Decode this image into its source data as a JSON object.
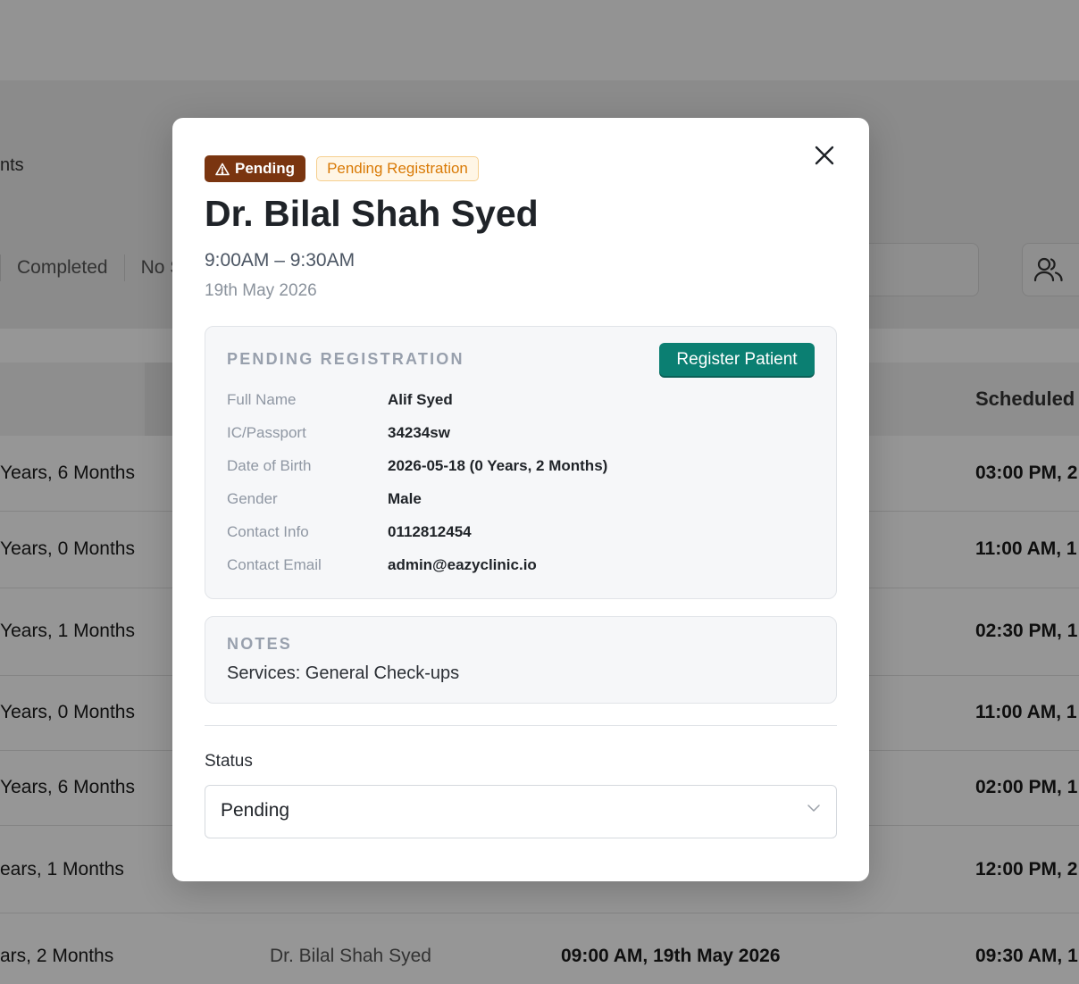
{
  "background": {
    "page_title_fragment": "nts",
    "tabs": [
      "Completed",
      "No S"
    ],
    "table_header_scheduled": "Scheduled E",
    "rows": [
      {
        "age": "Years, 6 Months",
        "time": "03:00 PM, 2"
      },
      {
        "age": "Years, 0 Months",
        "time": "11:00 AM, 1"
      },
      {
        "age": "Years, 1 Months",
        "time": "02:30 PM, 1"
      },
      {
        "age": "Years, 0 Months",
        "time": "11:00 AM, 1"
      },
      {
        "age": "Years, 6 Months",
        "time": "02:00 PM, 1"
      },
      {
        "age": "ears, 1 Months",
        "time": "12:00 PM, 2"
      },
      {
        "age": "ars, 2 Months",
        "doctor": "Dr. Bilal Shah Syed",
        "appointment": "09:00 AM, 19th May 2026",
        "time": "09:30 AM, 1"
      }
    ]
  },
  "modal": {
    "status_badge": "Pending",
    "status_badge_icon": "warning-icon",
    "registration_badge": "Pending Registration",
    "doctor_name": "Dr. Bilal Shah Syed",
    "time_range": "9:00AM – 9:30AM",
    "date": "19th May 2026",
    "pending_registration": {
      "title": "PENDING REGISTRATION",
      "register_button": "Register Patient",
      "fields": [
        {
          "label": "Full Name",
          "value": "Alif Syed"
        },
        {
          "label": "IC/Passport",
          "value": "34234sw"
        },
        {
          "label": "Date of Birth",
          "value": "2026-05-18 (0 Years, 2 Months)"
        },
        {
          "label": "Gender",
          "value": "Male"
        },
        {
          "label": "Contact Info",
          "value": "0112812454"
        },
        {
          "label": "Contact Email",
          "value": "admin@eazyclinic.io"
        }
      ]
    },
    "notes": {
      "title": "NOTES",
      "text": "Services: General Check-ups"
    },
    "status": {
      "label": "Status",
      "value": "Pending"
    }
  },
  "colors": {
    "status_badge_bg": "#7a3510",
    "registration_badge_text": "#d97a06",
    "registration_badge_bg": "#fff6e6",
    "register_button_bg": "#0b7f72",
    "overlay": "rgba(0,0,0,0.41)"
  }
}
